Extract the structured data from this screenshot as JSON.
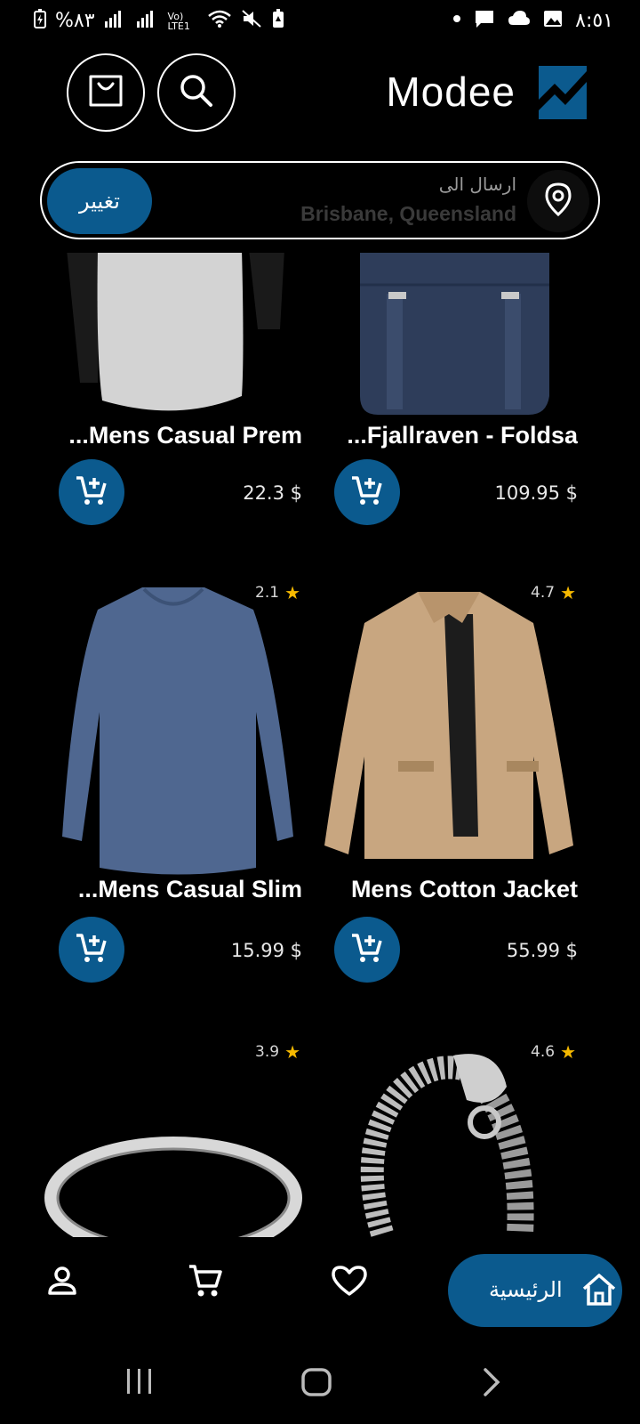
{
  "status_bar": {
    "battery_text": "%٨٣",
    "network": "Vo) LTE1",
    "time": "٨:٥١"
  },
  "header": {
    "brand": "Modee",
    "colors": {
      "accent": "#0b5a8e"
    }
  },
  "location": {
    "label": "ارسال الى",
    "value": "Brisbane, Queensland",
    "change_label": "تغيير"
  },
  "products": [
    {
      "title": "...Mens Casual Prem",
      "price": "22.3 $",
      "rating": ""
    },
    {
      "title": "...Fjallraven - Foldsa",
      "price": "109.95 $",
      "rating": ""
    },
    {
      "title": "...Mens Casual Slim",
      "price": "15.99 $",
      "rating": "2.1"
    },
    {
      "title": "Mens Cotton Jacket",
      "price": "55.99 $",
      "rating": "4.7"
    },
    {
      "title": "",
      "price": "",
      "rating": "3.9"
    },
    {
      "title": "",
      "price": "",
      "rating": "4.6"
    }
  ],
  "bottom_nav": {
    "home_label": "الرئيسية",
    "items": [
      "profile-icon",
      "cart-icon",
      "heart-icon",
      "home-icon"
    ]
  }
}
